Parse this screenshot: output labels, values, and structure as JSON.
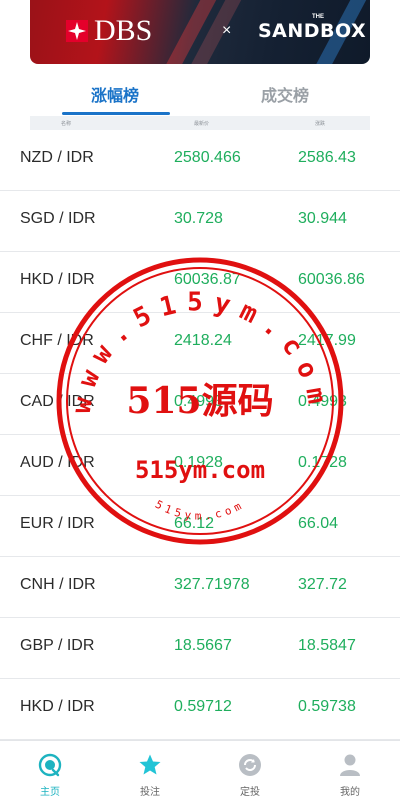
{
  "banner": {
    "brand_left": "DBS",
    "separator": "×",
    "brand_right": "SANDBOX",
    "brand_right_prefix": "THE"
  },
  "tabs": [
    {
      "label": "涨幅榜",
      "active": true
    },
    {
      "label": "成交榜",
      "active": false
    }
  ],
  "column_headers": [
    "名称",
    "最新价",
    "涨跌"
  ],
  "rows": [
    {
      "pair": "NZD / IDR",
      "price": "2580.466",
      "change": "2586.43"
    },
    {
      "pair": "SGD / IDR",
      "price": "30.728",
      "change": "30.944"
    },
    {
      "pair": "HKD / IDR",
      "price": "60036.87",
      "change": "60036.86"
    },
    {
      "pair": "CHF / IDR",
      "price": "2418.24",
      "change": "2417.99"
    },
    {
      "pair": "CAD / IDR",
      "price": "0.4993",
      "change": "0.4993"
    },
    {
      "pair": "AUD / IDR",
      "price": "0.1928",
      "change": "0.1728"
    },
    {
      "pair": "EUR / IDR",
      "price": "66.12",
      "change": "66.04"
    },
    {
      "pair": "CNH / IDR",
      "price": "327.71978",
      "change": "327.72"
    },
    {
      "pair": "GBP / IDR",
      "price": "18.5667",
      "change": "18.5847"
    },
    {
      "pair": "HKD / IDR",
      "price": "0.59712",
      "change": "0.59738"
    }
  ],
  "watermark": {
    "top_arc": "www.515ym.com",
    "center": "515源码",
    "domain": "515ym.com",
    "bottom_arc": "515ym.com"
  },
  "bottom_nav": [
    {
      "label": "主页",
      "icon": "home-icon",
      "active": true
    },
    {
      "label": "投注",
      "icon": "star-icon",
      "active": false
    },
    {
      "label": "定投",
      "icon": "refresh-icon",
      "active": false
    },
    {
      "label": "我的",
      "icon": "user-icon",
      "active": false
    }
  ],
  "colors": {
    "accent": "#1a73c8",
    "rise": "#1fae5d",
    "nav_active": "#1db3c0",
    "stamp": "#e01010"
  }
}
